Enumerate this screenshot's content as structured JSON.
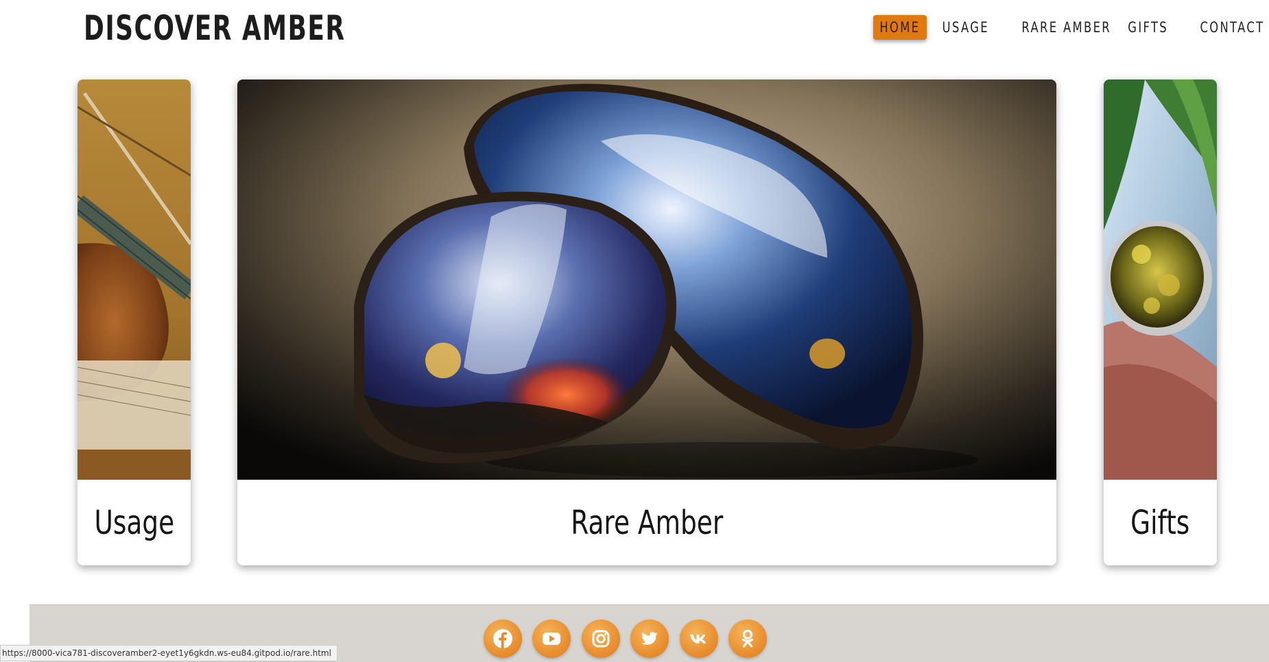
{
  "site": {
    "title": "DISCOVER AMBER"
  },
  "nav": {
    "items": [
      {
        "label": "HOME",
        "active": true
      },
      {
        "label": "USAGE",
        "active": false
      },
      {
        "label": "RARE AMBER",
        "active": false
      },
      {
        "label": "GIFTS",
        "active": false
      },
      {
        "label": "CONTACT ME",
        "active": false
      }
    ]
  },
  "carousel": {
    "cards": [
      {
        "label": "Usage",
        "image": "violin-photo"
      },
      {
        "label": "Rare Amber",
        "image": "blue-amber-stones-photo"
      },
      {
        "label": "Gifts",
        "image": "green-amber-ring-photo"
      }
    ]
  },
  "footer": {
    "social": [
      "facebook-icon",
      "youtube-icon",
      "instagram-icon",
      "twitter-icon",
      "vk-icon",
      "odnoklassniki-icon"
    ]
  },
  "status_bar": {
    "url": "https://8000-vica781-discoveramber2-eyet1y6gkdn.ws-eu84.gitpod.io/rare.html"
  },
  "colors": {
    "accent": "#e07a10",
    "footer_bg": "#d8d4d0",
    "social_icon_bg": "#e68a2a"
  }
}
